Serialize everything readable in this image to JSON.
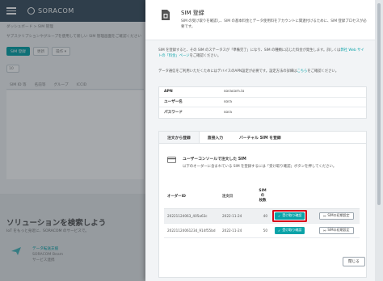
{
  "app": {
    "logo": "SORACOM"
  },
  "background": {
    "breadcrumb": "ダッシュボード > SIM 管理",
    "description": "サブスクリプションやグループを使用して新しい SIM 管理画面をご確認ください",
    "toolbar": {
      "register_button": "SIM 登録",
      "refresh_button": "更新",
      "actions_button": "操作 ▾"
    },
    "select_value": "10",
    "columns": [
      "SIM ID 等",
      "名前等",
      "グループ",
      "ICCID"
    ],
    "promo": {
      "title": "ソリューションを検索しよう",
      "subtitle": "IoT をもっと身近に、SORACOM のサービスで。",
      "item_title": "データ転送支援",
      "item_sub": "SORACOM Beam",
      "item_sub2": "サービス連携"
    }
  },
  "drawer": {
    "title": "SIM 登録",
    "description": "SIM の受け取りを確認し、SIM の基本料金とデータ使用料をアカウントに関連付けるために、SIM 登録プロセスが必要です。",
    "notice_pre": "SIM を登録すると、その SIM のステータスが「準備完了」になり、SIM の種類に応じた料金が発生します。詳しくは",
    "notice_link": "弊社 Web サイトの「料金」ページ",
    "notice_post": "をご確認ください。",
    "apn_notice_pre": "データ通信をご利用いただくためにはデバイスのAPN設定が必要です。設定方法の詳細は",
    "apn_notice_link": "こちら",
    "apn_notice_post": "をご確認ください。",
    "apn": {
      "apn_key": "APN",
      "apn_value": "soracom.io",
      "user_key": "ユーザー名",
      "user_value": "sora",
      "pass_key": "パスワード",
      "pass_value": "sora"
    },
    "tabs": [
      "注文から登録",
      "直接入力",
      "バーチャル SIM を登録"
    ],
    "panel": {
      "title": "ユーザーコンソールで注文した SIM",
      "subtitle": "以下のオーダーに含まれている SIM を登録するには「受け取り確認」ボタンを押してください。"
    },
    "orders_table": {
      "headers": {
        "order_id": "オーダーID",
        "date": "注文日",
        "sim_count_1": "SIM",
        "sim_count_2": "の",
        "sim_count_3": "枚数"
      },
      "rows": [
        {
          "order_id": "20221124063_405a63c",
          "date": "2022-11-24",
          "count": "40",
          "confirm_label": "受け取り確認",
          "settings_label": "SIMの初期設定"
        },
        {
          "order_id": "20221124061234_914f55bd",
          "date": "2022-11-24",
          "count": "50",
          "confirm_label": "受け取り確認",
          "settings_label": "SIMの初期設定"
        }
      ]
    },
    "close_button": "閉じる"
  },
  "colors": {
    "accent": "#0aa3a8",
    "header": "#3f5363",
    "highlight": "#d90a1a"
  }
}
